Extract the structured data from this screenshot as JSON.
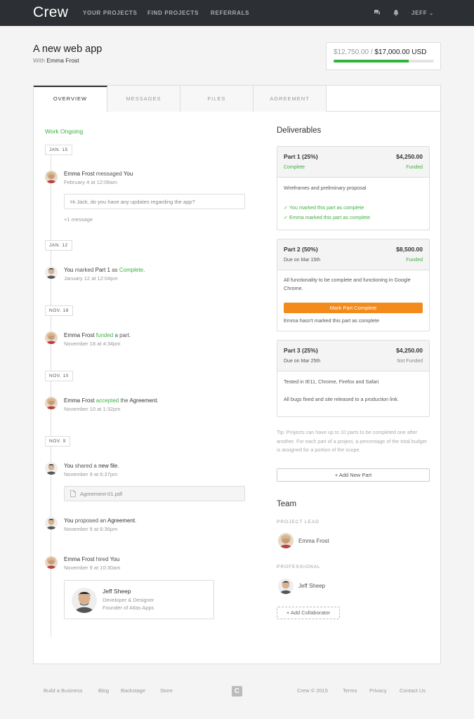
{
  "nav": {
    "logo": "Crew",
    "links": [
      "YOUR PROJECTS",
      "FIND PROJECTS",
      "REFERRALS"
    ],
    "icons": [
      "chat-icon",
      "bell-icon"
    ],
    "user": "JEFF"
  },
  "project": {
    "title": "A new web app",
    "with_prefix": "With",
    "with_name": "Emma Frost",
    "raised": "$12,750.00",
    "separator": "/",
    "total": "$17,000.00 USD",
    "progress": 0.75
  },
  "tabs": [
    "OVERVIEW",
    "MESSAGES",
    "FILES",
    "AGREEMENT"
  ],
  "timeline": {
    "status": "Work Ongoing",
    "dates": [
      "JAN. 15",
      "JAN. 12",
      "NOV. 18",
      "NOV. 10",
      "NOV. 9"
    ],
    "events": [
      {
        "actor": "Emma Frost",
        "verb": " messaged ",
        "object": "You",
        "time": "February 4 at 12:08am"
      },
      {
        "actor": "You",
        "verb": " marked ",
        "object": "Part 1",
        "mid": " as ",
        "highlight": "Complete",
        "end": ".",
        "time": "January 12 at 12:04pm"
      },
      {
        "actor": "Emma Frost",
        "highlight": " funded",
        "end": " a part.",
        "time": "November 18 at 4:34pm"
      },
      {
        "actor": "Emma Frost",
        "highlight": " accepted",
        "verb": " the ",
        "object": "Agreement",
        "end": ".",
        "time": "November 10 at 1:32pm"
      },
      {
        "actor": "You",
        "verb": " shared a ",
        "object": "new file",
        "end": ".",
        "time": "November 9 at 6:37pm"
      },
      {
        "actor": "You",
        "verb": " proposed an ",
        "object": "Agreement",
        "end": ".",
        "time": "November 9 at 6:36pm"
      },
      {
        "actor": "Emma Frost",
        "verb": " hired ",
        "object": "You",
        "time": "November 9 at 10:30am"
      }
    ],
    "message_preview": "Hi Jack, do you have any updates regarding the app?",
    "more_messages": "+1 message",
    "file_name": "Agreement-01.pdf",
    "contact": {
      "name": "Jeff Sheep",
      "role": "Developer & Designer",
      "company": "Founder of Atlas Apps"
    }
  },
  "deliverables": {
    "title": "Deliverables",
    "parts": [
      {
        "name": "Part 1 (25%)",
        "amount": "$4,250.00",
        "sub": "Complete",
        "funding": "Funded",
        "description": "Wireframes and preliminary proposal",
        "checks": [
          "You marked this part as complete",
          "Emma marked this part as complete"
        ]
      },
      {
        "name": "Part 2 (50%)",
        "amount": "$8,500.00",
        "sub": "Due on Mar 15th",
        "funding": "Funded",
        "description": "All functionality to be complete and functioning in Google Chrome.",
        "button": "Mark Part Complete",
        "note": "Emma hasn't marked this part as complete"
      },
      {
        "name": "Part 3 (25%)",
        "amount": "$4,250.00",
        "sub": "Due on Mar 25th",
        "funding": "Not Funded",
        "description": "Tested in IE11, Chrome, Firefox and Safari",
        "description2": "All bugs fixed and site released to a production link."
      }
    ],
    "tip": "Tip: Projects can have up to 10 parts to be completed one after another. For each part of a project, a percentage of the total budget is assigned for a portion of the scope.",
    "add_part": "+ Add New Part"
  },
  "team": {
    "title": "Team",
    "lead_label": "PROJECT LEAD",
    "lead_name": "Emma Frost",
    "pro_label": "PROFESSIONAL",
    "pro_name": "Jeff Sheep",
    "add_collab": "+ Add Collaborator"
  },
  "footer": {
    "left": [
      "Build a Business",
      "Blog",
      "Backstage",
      "Store"
    ],
    "logo": "C",
    "copyright": "Crew © 2015",
    "right": [
      "Terms",
      "Privacy",
      "Contact Us"
    ]
  },
  "colors": {
    "green": "#3cb040",
    "orange": "#f28a1c",
    "nav": "#2c2f33"
  }
}
